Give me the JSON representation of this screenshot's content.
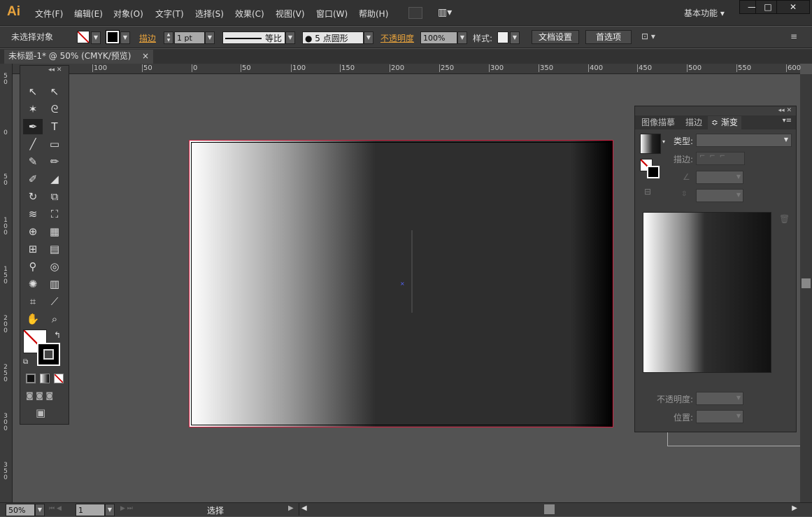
{
  "app": {
    "logo": "Ai",
    "menus": [
      "文件(F)",
      "编辑(E)",
      "对象(O)",
      "文字(T)",
      "选择(S)",
      "效果(C)",
      "视图(V)",
      "窗口(W)",
      "帮助(H)"
    ],
    "workspace": "基本功能 ▾",
    "window_buttons": [
      "—",
      "□",
      "✕"
    ]
  },
  "control": {
    "selection": "未选择对象",
    "stroke_label": "描边",
    "stroke_weight": "1 pt",
    "stroke_profile": "等比",
    "brush": "● 5 点圆形",
    "opacity_label": "不透明度",
    "opacity": "100%",
    "style_label": "样式:",
    "doc_setup": "文档设置",
    "preferences": "首选项"
  },
  "document": {
    "tab_title": "未标题-1* @ 50% (CMYK/预览)",
    "close": "×"
  },
  "rulers": {
    "h": [
      "100",
      "50",
      "0",
      "50",
      "100",
      "150",
      "200",
      "250",
      "300",
      "350",
      "400",
      "450",
      "500",
      "550",
      "600"
    ],
    "v": [
      "5 0",
      "0",
      "5 0",
      "1 0 0",
      "1 5 0",
      "2 0 0",
      "2 5 0",
      "3 0 0",
      "3 5 0"
    ]
  },
  "tools": [
    [
      "selection-icon",
      "↖"
    ],
    [
      "direct-selection-icon",
      "↖"
    ],
    [
      "magic-wand-icon",
      "✶"
    ],
    [
      "lasso-icon",
      "ᘓ"
    ],
    [
      "pen-icon",
      "✒"
    ],
    [
      "type-icon",
      "T"
    ],
    [
      "line-icon",
      "╱"
    ],
    [
      "rectangle-icon",
      "▭"
    ],
    [
      "paintbrush-icon",
      "✎"
    ],
    [
      "pencil-icon",
      "✏"
    ],
    [
      "blob-brush-icon",
      "✐"
    ],
    [
      "eraser-icon",
      "◢"
    ],
    [
      "rotate-icon",
      "↻"
    ],
    [
      "scale-icon",
      "⧉"
    ],
    [
      "warp-icon",
      "≋"
    ],
    [
      "free-transform-icon",
      "⛶"
    ],
    [
      "shape-builder-icon",
      "⊕"
    ],
    [
      "perspective-icon",
      "▦"
    ],
    [
      "mesh-icon",
      "⊞"
    ],
    [
      "gradient-icon",
      "▤"
    ],
    [
      "eyedropper-icon",
      "⚲"
    ],
    [
      "blend-icon",
      "◎"
    ],
    [
      "symbol-sprayer-icon",
      "✺"
    ],
    [
      "column-graph-icon",
      "▥"
    ],
    [
      "artboard-icon",
      "⌗"
    ],
    [
      "slice-icon",
      "⟋"
    ],
    [
      "hand-icon",
      "✋"
    ],
    [
      "zoom-icon",
      "⌕"
    ]
  ],
  "panel": {
    "tabs": [
      "图像描摹",
      "描边",
      "≎ 渐变"
    ],
    "type_label": "类型:",
    "stroke_label": "描边:",
    "opacity_label": "不透明度:",
    "position_label": "位置:"
  },
  "status": {
    "zoom": "50%",
    "page": "1",
    "tool": "选择"
  },
  "colors": {
    "accent": "#e8a33c",
    "canvas": "#535353",
    "artboard_border": "#d02040"
  }
}
